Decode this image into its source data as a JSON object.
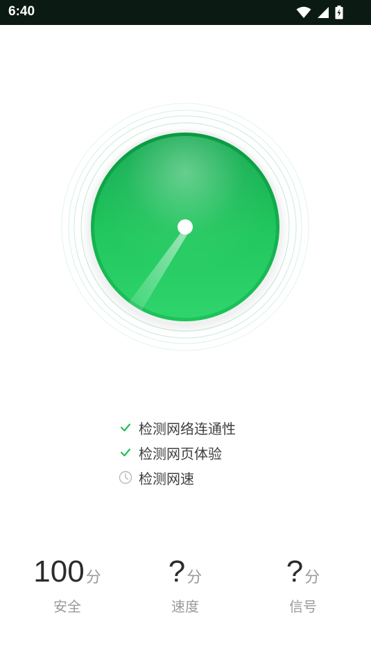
{
  "status_bar": {
    "time": "6:40",
    "icons": [
      "wifi-icon",
      "cellular-signal-icon",
      "battery-charging-icon"
    ]
  },
  "gauge": {
    "colors": {
      "outer_start": "#0ea84c",
      "outer_end": "#2ed36b",
      "ring": "#cfeee0",
      "dot": "#ffffff"
    }
  },
  "checklist": [
    {
      "label": "检测网络连通性",
      "status": "done",
      "icon": "checkmark-icon"
    },
    {
      "label": "检测网页体验",
      "status": "done",
      "icon": "checkmark-icon"
    },
    {
      "label": "检测网速",
      "status": "pending",
      "icon": "clock-icon"
    }
  ],
  "scores": [
    {
      "value": "100",
      "unit": "分",
      "label": "安全"
    },
    {
      "value": "?",
      "unit": "分",
      "label": "速度"
    },
    {
      "value": "?",
      "unit": "分",
      "label": "信号"
    }
  ]
}
